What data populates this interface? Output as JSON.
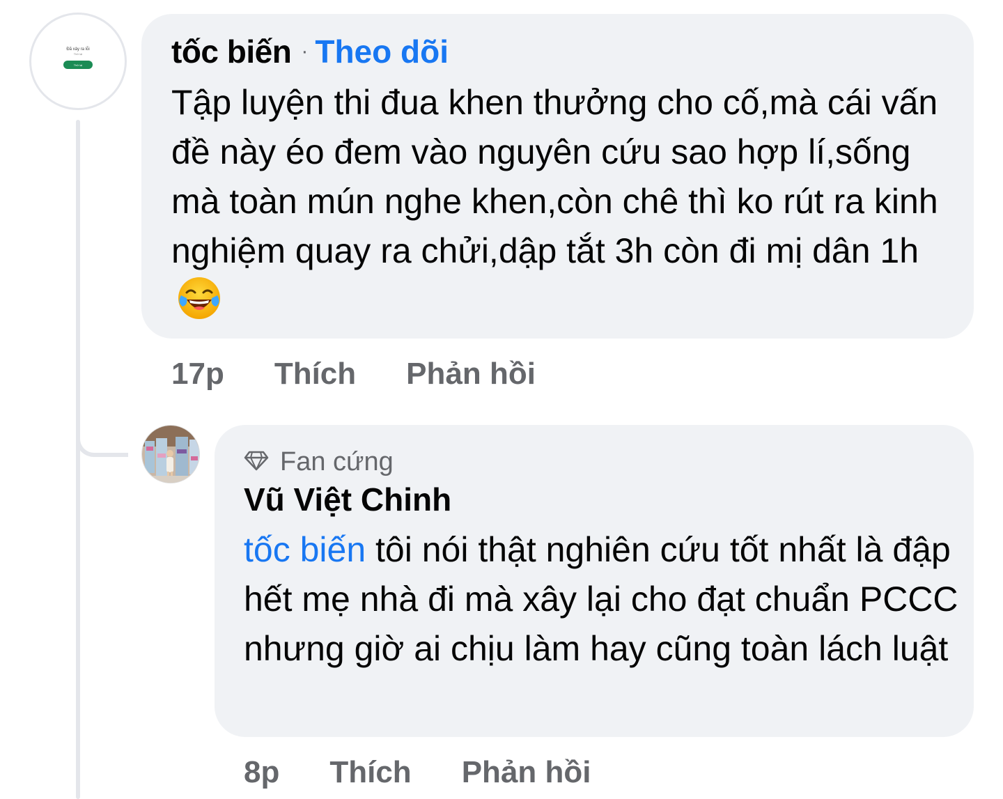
{
  "comment1": {
    "avatar": {
      "error_title": "Đã xảy ra lỗi",
      "error_subtitle": "Thử lại",
      "retry_label": "Thử lại"
    },
    "author": "tốc biến",
    "separator": "·",
    "follow_label": "Theo dõi",
    "text": "Tập luyện thi đua khen thưởng cho cố,mà cái vấn đề này éo đem vào nguyên cứu sao hợp lí,sống mà toàn mún nghe khen,còn chê thì ko rút ra kinh nghiệm quay ra chửi,dập tắt 3h còn đi mị dân 1h",
    "emoji_icon": "face-with-tears-of-joy-icon",
    "time": "17p",
    "like_label": "Thích",
    "reply_label": "Phản hồi"
  },
  "comment2": {
    "badge_icon": "diamond-icon",
    "badge": "Fan cứng",
    "author": "Vũ Việt Chinh",
    "mention": "tốc biến",
    "text": " tôi nói thật nghiên cứu tốt nhất là đập hết mẹ nhà đi mà xây lại cho đạt chuẩn PCCC nhưng giờ ai chịu làm hay cũng toàn lách luật",
    "time": "8p",
    "like_label": "Thích",
    "reply_label": "Phản hồi"
  },
  "colors": {
    "bubble": "#f0f2f5",
    "link": "#1877f2",
    "meta": "#65676b",
    "thread_line": "#e4e6eb"
  }
}
